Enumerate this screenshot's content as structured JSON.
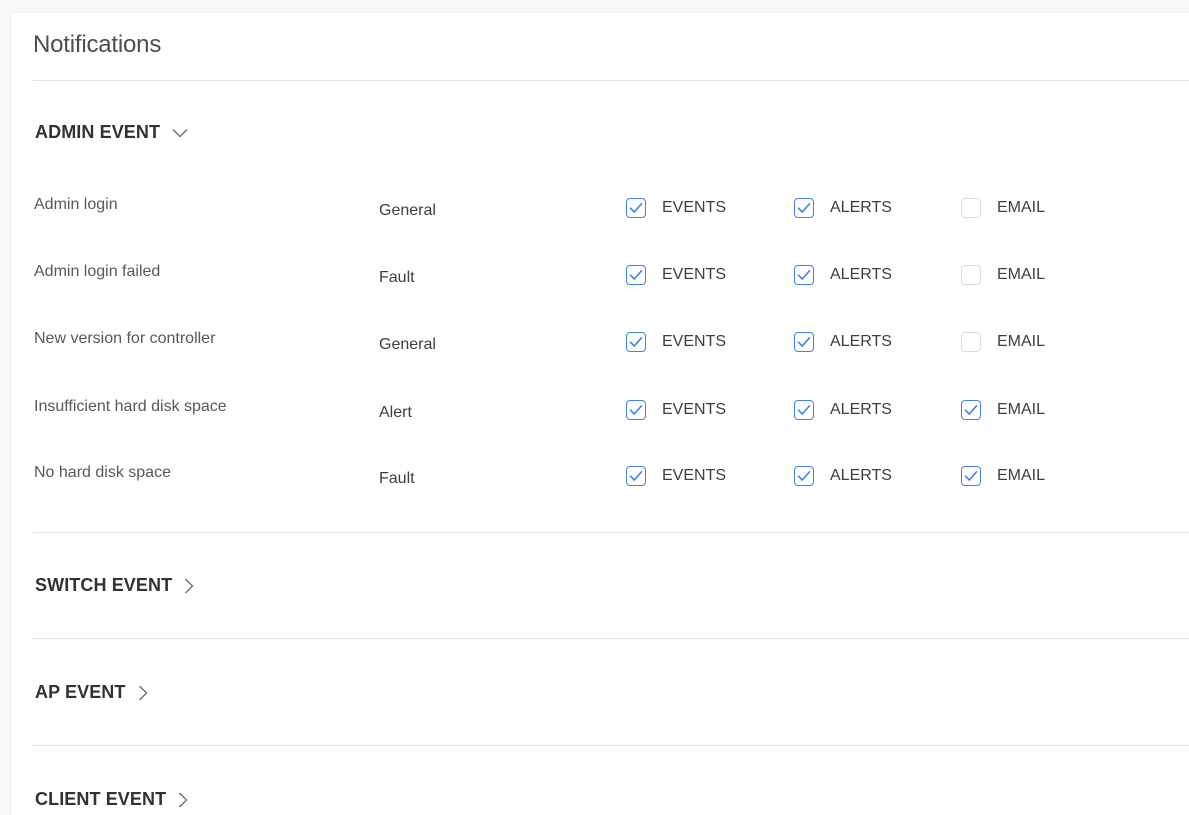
{
  "page": {
    "title": "Notifications"
  },
  "sections": [
    {
      "label": "ADMIN EVENT",
      "expanded": true
    },
    {
      "label": "SWITCH EVENT",
      "expanded": false
    },
    {
      "label": "AP EVENT",
      "expanded": false
    },
    {
      "label": "CLIENT EVENT",
      "expanded": false
    }
  ],
  "option_labels": {
    "events": "EVENTS",
    "alerts": "ALERTS",
    "email": "EMAIL"
  },
  "admin_events": [
    {
      "name": "Admin login",
      "category": "General",
      "events": true,
      "alerts": true,
      "email": false
    },
    {
      "name": "Admin login failed",
      "category": "Fault",
      "events": true,
      "alerts": true,
      "email": false
    },
    {
      "name": "New version for controller",
      "category": "General",
      "events": true,
      "alerts": true,
      "email": false
    },
    {
      "name": "Insufficient hard disk space",
      "category": "Alert",
      "events": true,
      "alerts": true,
      "email": true
    },
    {
      "name": "No hard disk space",
      "category": "Fault",
      "events": true,
      "alerts": true,
      "email": true
    }
  ],
  "colors": {
    "accent": "#3d84e6",
    "unchecked_border": "#d9dbde",
    "divider": "#e3e5e8"
  },
  "icons": {
    "expanded": "chevron-down-icon",
    "collapsed": "chevron-right-icon",
    "checked": "checkmark-icon"
  }
}
